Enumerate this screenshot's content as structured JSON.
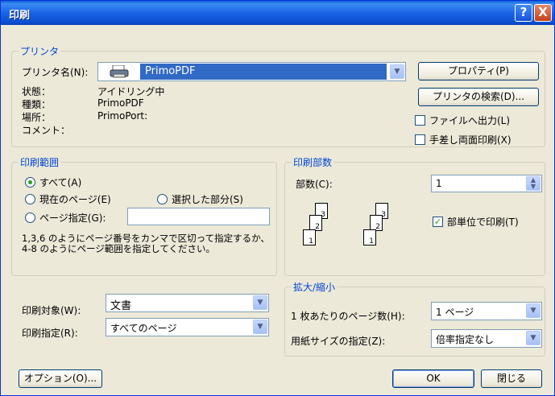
{
  "title": "印刷",
  "titlebar": {
    "help": "?",
    "close": "X"
  },
  "printer": {
    "legend": "プリンタ",
    "name_label": "プリンタ名(N):",
    "name_value": "PrimoPDF",
    "properties_button": "プロパティ(P)",
    "search_button": "プリンタの検索(D)...",
    "status_label": "状態：",
    "status_value": "アイドリング中",
    "type_label": "種類：",
    "type_value": "PrimoPDF",
    "location_label": "場所：",
    "location_value": "PrimoPort:",
    "comment_label": "コメント：",
    "comment_value": "",
    "print_to_file": "ファイルへ出力(L)",
    "manual_duplex": "手差し両面印刷(X)"
  },
  "range": {
    "legend": "印刷範囲",
    "all": "すべて(A)",
    "current": "現在のページ(E)",
    "selection": "選択した部分(S)",
    "pages": "ページ指定(G):",
    "pages_value": "",
    "hint": "1,3,6 のようにページ番号をカンマで区切って指定するか、4-8 のようにページ範囲を指定してください。"
  },
  "copies": {
    "legend": "印刷部数",
    "count_label": "部数(C):",
    "count_value": "1",
    "collate": "部単位で印刷(T)",
    "collate_checked": true,
    "pages_set1": [
      "3",
      "2",
      "1"
    ],
    "pages_set2": [
      "3",
      "2",
      "1"
    ]
  },
  "what": {
    "target_label": "印刷対象(W):",
    "target_value": "文書",
    "print_label": "印刷指定(R):",
    "print_value": "すべてのページ"
  },
  "zoom": {
    "legend": "拡大/縮小",
    "pps_label": "1 枚あたりのページ数(H):",
    "pps_value": "1 ページ",
    "paper_label": "用紙サイズの指定(Z):",
    "paper_value": "倍率指定なし"
  },
  "buttons": {
    "options": "オプション(O)...",
    "ok": "OK",
    "close": "閉じる"
  }
}
